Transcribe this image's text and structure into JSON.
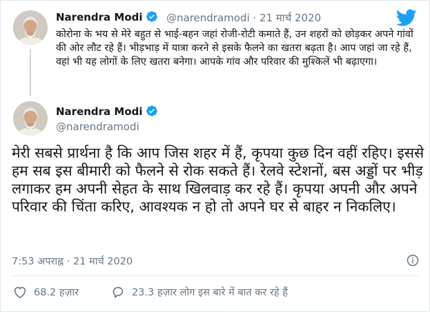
{
  "quoted_tweet": {
    "author_name": "Narendra Modi",
    "handle": "@narendramodi",
    "separator": "·",
    "date": "21 मार्च 2020",
    "text": "कोरोना के भय से मेरे बहुत से भाई-बहन जहां रोजी-रोटी कमाते हैं, उन शहरों को छोड़कर अपने गांवों की ओर लौट रहे हैं। भीड़भाड़ में यात्रा करने से इसके फैलने का खतरा बढ़ता है। आप जहां जा रहे हैं, वहां भी यह लोगों के लिए खतरा बनेगा। आपके गांव और परिवार की मुश्किलें भी बढ़ाएगा।"
  },
  "main_tweet": {
    "author_name": "Narendra Modi",
    "handle": "@narendramodi",
    "text": "मेरी सबसे प्रार्थना है कि आप जिस शहर में हैं, कृपया कुछ दिन वहीं रहिए। इससे हम सब इस बीमारी को फैलने से रोक सकते हैं। रेलवे स्टेशनों, बस अड्डों पर भीड़ लगाकर हम अपनी सेहत के साथ खिलवाड़ कर रहे हैं। कृपया अपनी और अपने परिवार की चिंता करिए, आवश्यक न हो तो अपने घर से बाहर न निकलिए।",
    "time": "7:53 अपराह्न",
    "date": "21 मार्च 2020",
    "meta_separator": "·",
    "likes": "68.2 हज़ार",
    "conversation": "23.3 हज़ार लोग इस बारे में बात कर रहे हैं"
  },
  "icons": {
    "brand": "twitter-bird-icon",
    "verified": "verified-badge-icon",
    "info": "info-icon",
    "like": "heart-icon",
    "reply": "comment-icon"
  },
  "colors": {
    "brand_blue": "#1da1f2",
    "text_primary": "#14171a",
    "text_secondary": "#657786",
    "border": "#e1e8ed"
  }
}
